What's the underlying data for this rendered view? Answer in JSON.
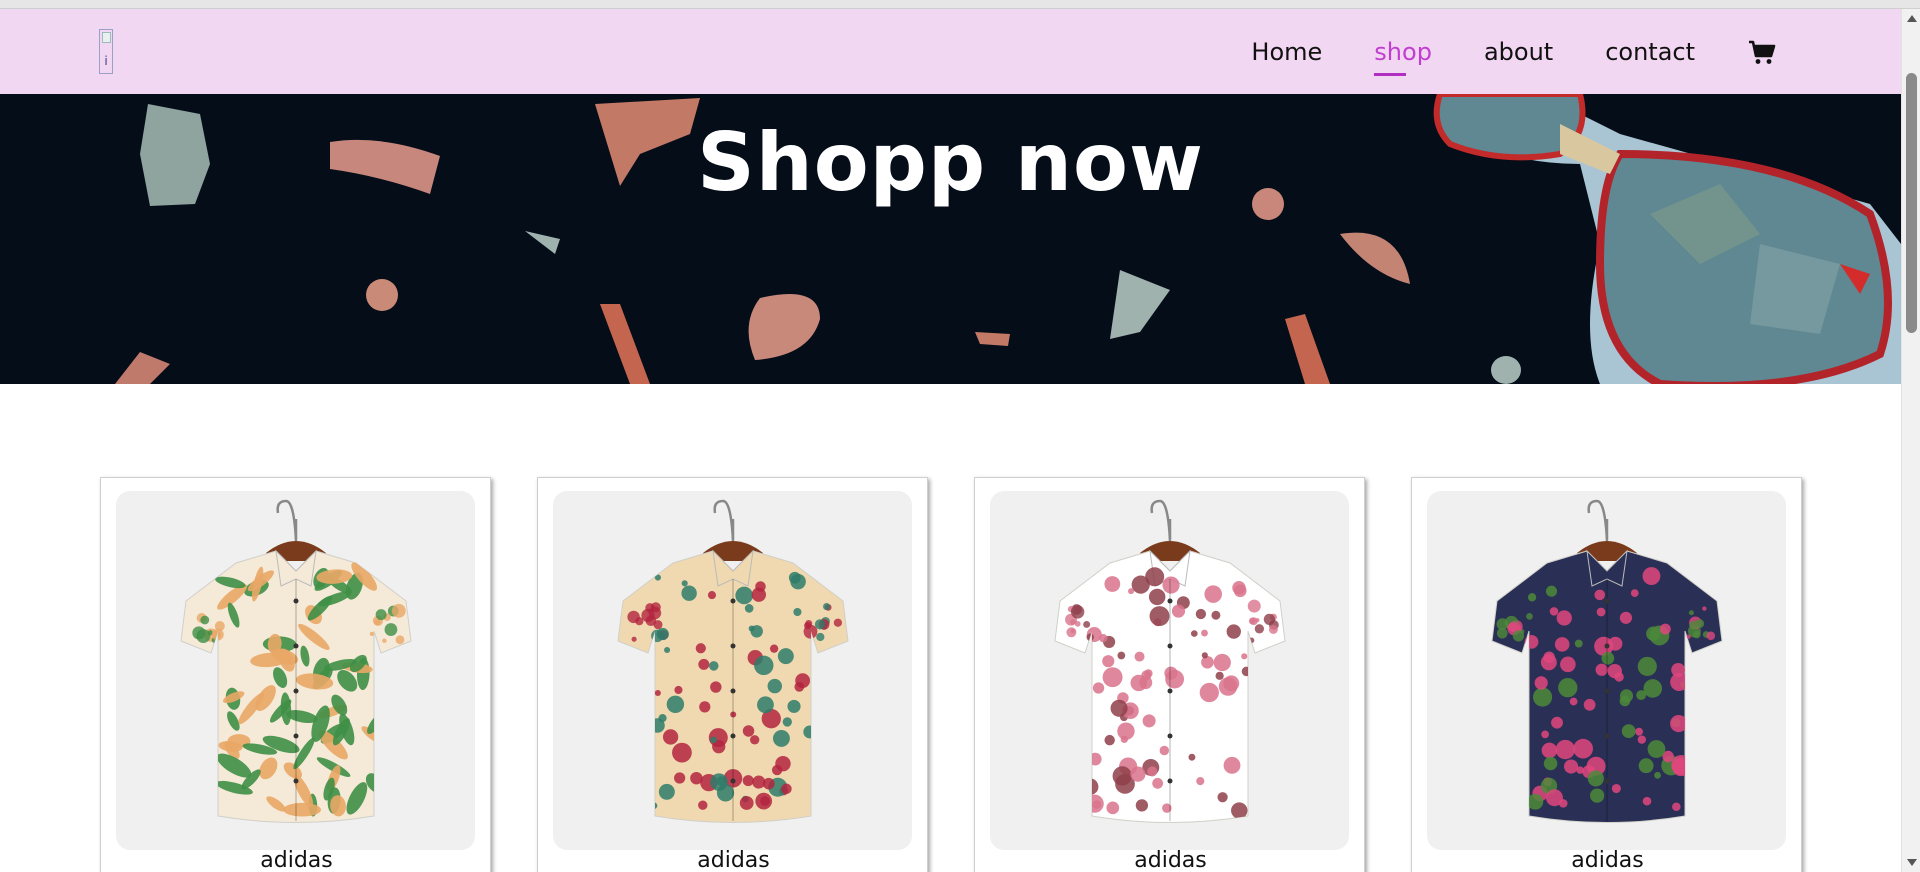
{
  "logo": {
    "alt": "i"
  },
  "nav": {
    "items": [
      {
        "label": "Home",
        "active": false
      },
      {
        "label": "shop",
        "active": true
      },
      {
        "label": "about",
        "active": false
      },
      {
        "label": "contact",
        "active": false
      }
    ],
    "cart_icon": "cart-icon"
  },
  "hero": {
    "title": "Shopp now"
  },
  "products": [
    {
      "brand": "adidas",
      "pattern": "green-leaf-floral",
      "colors": [
        "#f5ead8",
        "#3f8f46",
        "#e9a766"
      ]
    },
    {
      "brand": "adidas",
      "pattern": "vintage-floral",
      "colors": [
        "#f0d9b0",
        "#b3243f",
        "#2e7b6a"
      ]
    },
    {
      "brand": "adidas",
      "pattern": "pink-blossom",
      "colors": [
        "#ffffff",
        "#d9738c",
        "#8f3f4a"
      ]
    },
    {
      "brand": "adidas",
      "pattern": "navy-rose",
      "colors": [
        "#2a2f55",
        "#e0477e",
        "#4c8a3a"
      ]
    }
  ],
  "theme": {
    "accent": "#c13fd0",
    "navbar_bg": "#f2d7f2",
    "hero_bg": "#050d19"
  }
}
